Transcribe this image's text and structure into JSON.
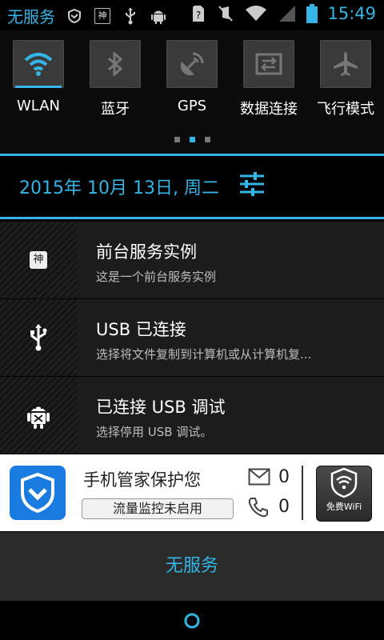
{
  "status_bar": {
    "carrier": "无服务",
    "time": "15:49",
    "shen_badge": "神"
  },
  "quick_toggles": [
    {
      "label": "WLAN",
      "icon": "wifi-icon",
      "active": true
    },
    {
      "label": "蓝牙",
      "icon": "bluetooth-icon",
      "active": false
    },
    {
      "label": "GPS",
      "icon": "gps-icon",
      "active": false
    },
    {
      "label": "数据连接",
      "icon": "data-connection-icon",
      "active": false
    },
    {
      "label": "飞行模式",
      "icon": "airplane-icon",
      "active": false
    }
  ],
  "date_header": {
    "date": "2015年 10月 13日, 周二"
  },
  "notifications": [
    {
      "badge": "神",
      "title": "前台服务实例",
      "subtitle": "这是一个前台服务实例"
    },
    {
      "title": "USB 已连接",
      "subtitle": "选择将文件复制到计算机或从计算机复..."
    },
    {
      "title": "已连接 USB 调试",
      "subtitle": "选择停用 USB 调试。"
    }
  ],
  "guard_widget": {
    "title": "手机管家保护您",
    "traffic_button": "流量监控未启用",
    "sms_count": "0",
    "call_count": "0",
    "wifi_label": "免费WiFi"
  },
  "no_service_label": "无服务",
  "colors": {
    "accent": "#33b5e5",
    "guard_blue": "#1a7be0"
  }
}
